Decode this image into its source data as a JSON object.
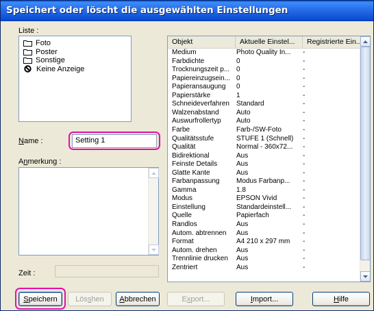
{
  "window": {
    "title": "Speichert oder löscht die ausgewählten Einstellungen"
  },
  "liste": {
    "label": "Liste :",
    "items": [
      {
        "icon": "folder-icon",
        "label": "Foto"
      },
      {
        "icon": "folder-icon",
        "label": "Poster"
      },
      {
        "icon": "folder-icon",
        "label": "Sonstige"
      },
      {
        "icon": "no-symbol-icon",
        "label": "Keine Anzeige"
      }
    ]
  },
  "name": {
    "label": "Name :",
    "value": "Setting 1"
  },
  "anmerkung": {
    "label": "Anmerkung :",
    "value": ""
  },
  "zeit": {
    "label": "Zeit :",
    "value": ""
  },
  "table": {
    "headers": [
      "Objekt",
      "Aktuelle Einstel...",
      "Registrierte Ein..."
    ],
    "rows": [
      [
        "Medium",
        "Photo Quality In...",
        "-"
      ],
      [
        "Farbdichte",
        "0",
        "-"
      ],
      [
        "Trocknungszeit p...",
        "0",
        "-"
      ],
      [
        "Papiereinzugsein...",
        "0",
        "-"
      ],
      [
        "Papieransaugung",
        "0",
        "-"
      ],
      [
        "Papierstärke",
        "1",
        "-"
      ],
      [
        "Schneideverfahren",
        "Standard",
        "-"
      ],
      [
        "Walzenabstand",
        "Auto",
        "-"
      ],
      [
        "Auswurfrollertyp",
        "Auto",
        "-"
      ],
      [
        "Farbe",
        "Farb-/SW-Foto",
        "-"
      ],
      [
        "Qualitätsstufe",
        "STUFE 1 (Schnell)",
        "-"
      ],
      [
        "Qualität",
        "Normal - 360x72...",
        "-"
      ],
      [
        "Bidirektional",
        "Aus",
        "-"
      ],
      [
        "Feinste Details",
        "Aus",
        "-"
      ],
      [
        "Glatte Kante",
        "Aus",
        "-"
      ],
      [
        "Farbanpassung",
        "Modus Farbanp...",
        "-"
      ],
      [
        "Gamma",
        "1.8",
        "-"
      ],
      [
        "Modus",
        "EPSON Vivid",
        "-"
      ],
      [
        "Einstellung",
        "Standardeinstell...",
        "-"
      ],
      [
        "Quelle",
        "Papierfach",
        "-"
      ],
      [
        "Randlos",
        "Aus",
        "-"
      ],
      [
        "Autom. abtrennen",
        "Aus",
        "-"
      ],
      [
        "Format",
        "A4 210 x 297 mm",
        "-"
      ],
      [
        "Autom. drehen",
        "Aus",
        "-"
      ],
      [
        "Trennlinie drucken",
        "Aus",
        "-"
      ],
      [
        "Zentriert",
        "Aus",
        "-"
      ]
    ]
  },
  "buttons": {
    "save": "Speichern",
    "delete": "Löschen",
    "cancel": "Abbrechen",
    "export": "Export...",
    "import": "Import...",
    "help": "Hilfe"
  },
  "colors": {
    "highlight": "#e60ea8",
    "titlebar": "#0b4ed4"
  }
}
